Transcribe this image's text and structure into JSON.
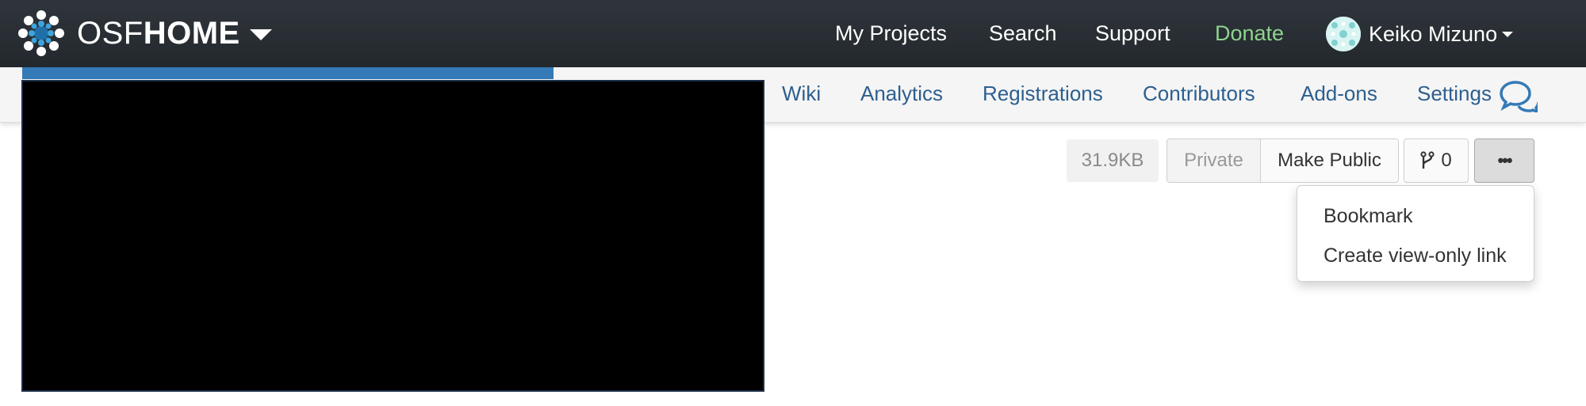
{
  "navbar": {
    "brand": {
      "osf": "OSF",
      "home": "HOME"
    },
    "links": [
      {
        "label": "My Projects"
      },
      {
        "label": "Search"
      },
      {
        "label": "Support"
      },
      {
        "label": "Donate"
      }
    ],
    "user": {
      "name": "Keiko Mizuno"
    }
  },
  "project_nav": {
    "links": [
      {
        "label": "Wiki"
      },
      {
        "label": "Analytics"
      },
      {
        "label": "Registrations"
      },
      {
        "label": "Contributors"
      },
      {
        "label": "Add-ons"
      },
      {
        "label": "Settings"
      }
    ]
  },
  "actions": {
    "size": "31.9KB",
    "privacy_label": "Private",
    "make_public_label": "Make Public",
    "fork_count": "0",
    "more_label": "•••"
  },
  "dropdown": {
    "items": [
      {
        "label": "Bookmark"
      },
      {
        "label": "Create view-only link"
      }
    ]
  },
  "colors": {
    "navbar_bg": "#2b3036",
    "donate": "#8fd28f",
    "link_blue": "#2d5f8f",
    "accent_blue": "#337ab7"
  },
  "icons": {
    "brand": "osf-flower-logo-icon",
    "brand_caret": "caret-down-icon",
    "user_caret": "caret-down-icon",
    "chat": "comments-icon",
    "fork": "code-fork-icon"
  }
}
